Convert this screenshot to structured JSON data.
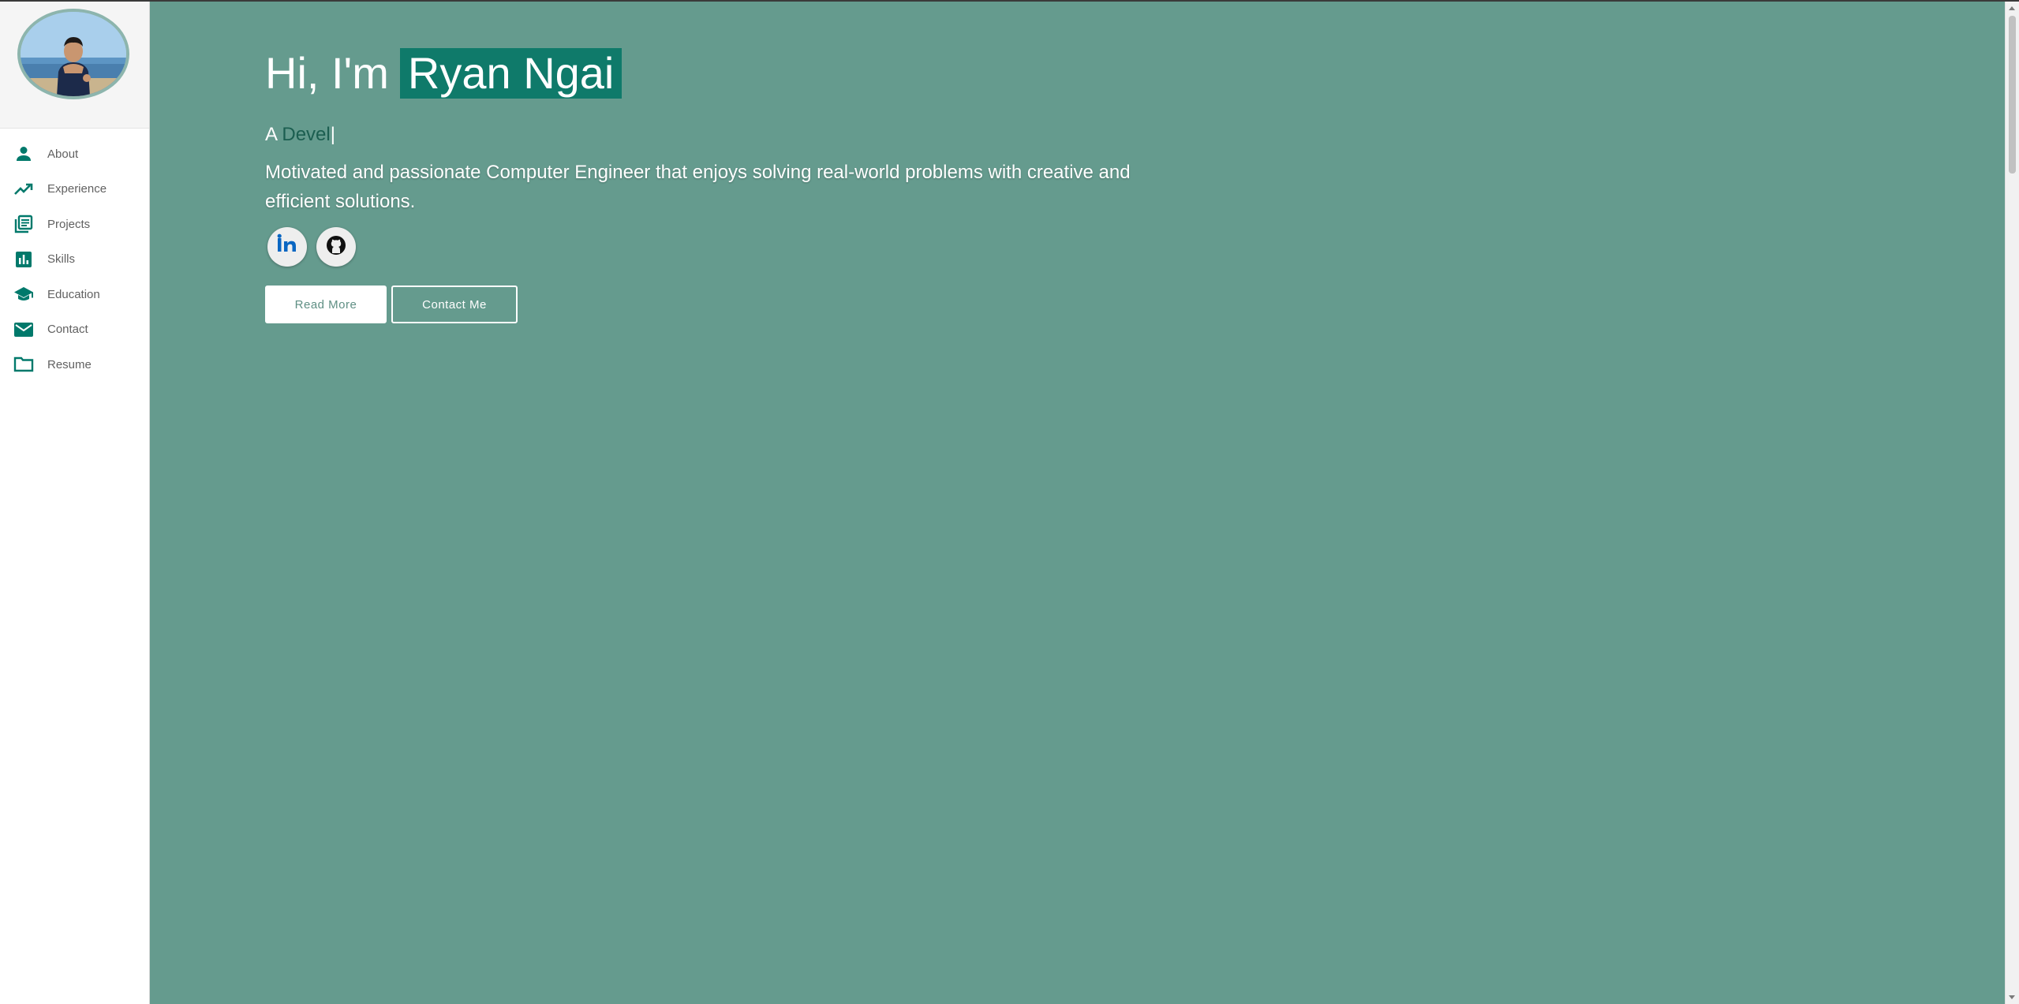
{
  "colors": {
    "accent": "#00796b",
    "hero_background": "#659b8e",
    "name_highlight": "#0f7a6a",
    "sidebar_text": "#616161"
  },
  "sidebar": {
    "avatar_alt": "Profile photo",
    "items": [
      {
        "label": "About",
        "icon": "person-icon"
      },
      {
        "label": "Experience",
        "icon": "trending-up-icon"
      },
      {
        "label": "Projects",
        "icon": "library-books-icon"
      },
      {
        "label": "Skills",
        "icon": "bar-chart-icon"
      },
      {
        "label": "Education",
        "icon": "school-icon"
      },
      {
        "label": "Contact",
        "icon": "mail-icon"
      },
      {
        "label": "Resume",
        "icon": "folder-icon"
      }
    ]
  },
  "hero": {
    "greeting_prefix": "Hi, I'm",
    "name": "Ryan Ngai",
    "typing_prefix": "A",
    "typing_word": "Devel",
    "cursor": "|",
    "intro": "Motivated and passionate Computer Engineer that enjoys solving real-world problems with creative and efficient solutions.",
    "socials": [
      {
        "icon": "linkedin-icon"
      },
      {
        "icon": "github-icon"
      }
    ],
    "read_more_label": "Read More",
    "contact_label": "Contact Me"
  }
}
